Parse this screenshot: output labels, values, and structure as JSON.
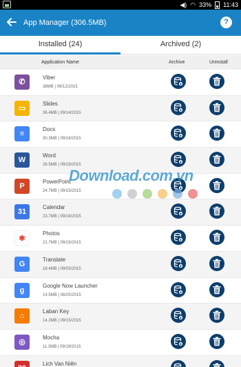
{
  "status_bar": {
    "battery": "33%",
    "time": "11:43"
  },
  "header": {
    "title": "App Manager (306.5MB)",
    "help_label": "?"
  },
  "tabs": [
    {
      "label": "Installed (24)",
      "active": true
    },
    {
      "label": "Archived (2)",
      "active": false
    }
  ],
  "columns": {
    "name": "Application Name",
    "archive": "Archive",
    "uninstall": "Uninstall"
  },
  "apps": [
    {
      "name": "Viber",
      "meta": "38MB | 09/12/2015",
      "icon": "viber-icon",
      "color": "#7b519d",
      "glyph": "✆"
    },
    {
      "name": "Slides",
      "meta": "36.4MB | 09/14/2015",
      "icon": "slides-icon",
      "color": "#f4b400",
      "glyph": "▭"
    },
    {
      "name": "Docs",
      "meta": "30.3MB | 09/18/2015",
      "icon": "docs-icon",
      "color": "#4285f4",
      "glyph": "≡"
    },
    {
      "name": "Word",
      "meta": "26.5MB | 09/18/2015",
      "icon": "word-icon",
      "color": "#2b579a",
      "glyph": "W"
    },
    {
      "name": "PowerPoint",
      "meta": "24.7MB | 09/15/2015",
      "icon": "powerpoint-icon",
      "color": "#d24726",
      "glyph": "P"
    },
    {
      "name": "Calendar",
      "meta": "23.7MB | 09/18/2015",
      "icon": "calendar-icon",
      "color": "#3b78e7",
      "glyph": "31"
    },
    {
      "name": "Photos",
      "meta": "21.7MB | 09/19/2015",
      "icon": "photos-icon",
      "color": "#ffffff",
      "glyph": "✱"
    },
    {
      "name": "Translate",
      "meta": "18.4MB | 09/03/2015",
      "icon": "translate-icon",
      "color": "#4285f4",
      "glyph": "G"
    },
    {
      "name": "Google Now Launcher",
      "meta": "14.5MB | 08/25/2015",
      "icon": "google-now-launcher-icon",
      "color": "#4285f4",
      "glyph": "g"
    },
    {
      "name": "Laban Key",
      "meta": "14.2MB | 09/15/2015",
      "icon": "laban-key-icon",
      "color": "#f57c00",
      "glyph": "⌂"
    },
    {
      "name": "Mocha",
      "meta": "11.3MB | 09/19/2015",
      "icon": "mocha-icon",
      "color": "#7e57c2",
      "glyph": "◎"
    },
    {
      "name": "Lich Van Niên",
      "meta": "",
      "icon": "lich-van-nien-icon",
      "color": "#d32f2f",
      "glyph": "30"
    }
  ],
  "watermark": {
    "text": "Download.com.vn"
  }
}
